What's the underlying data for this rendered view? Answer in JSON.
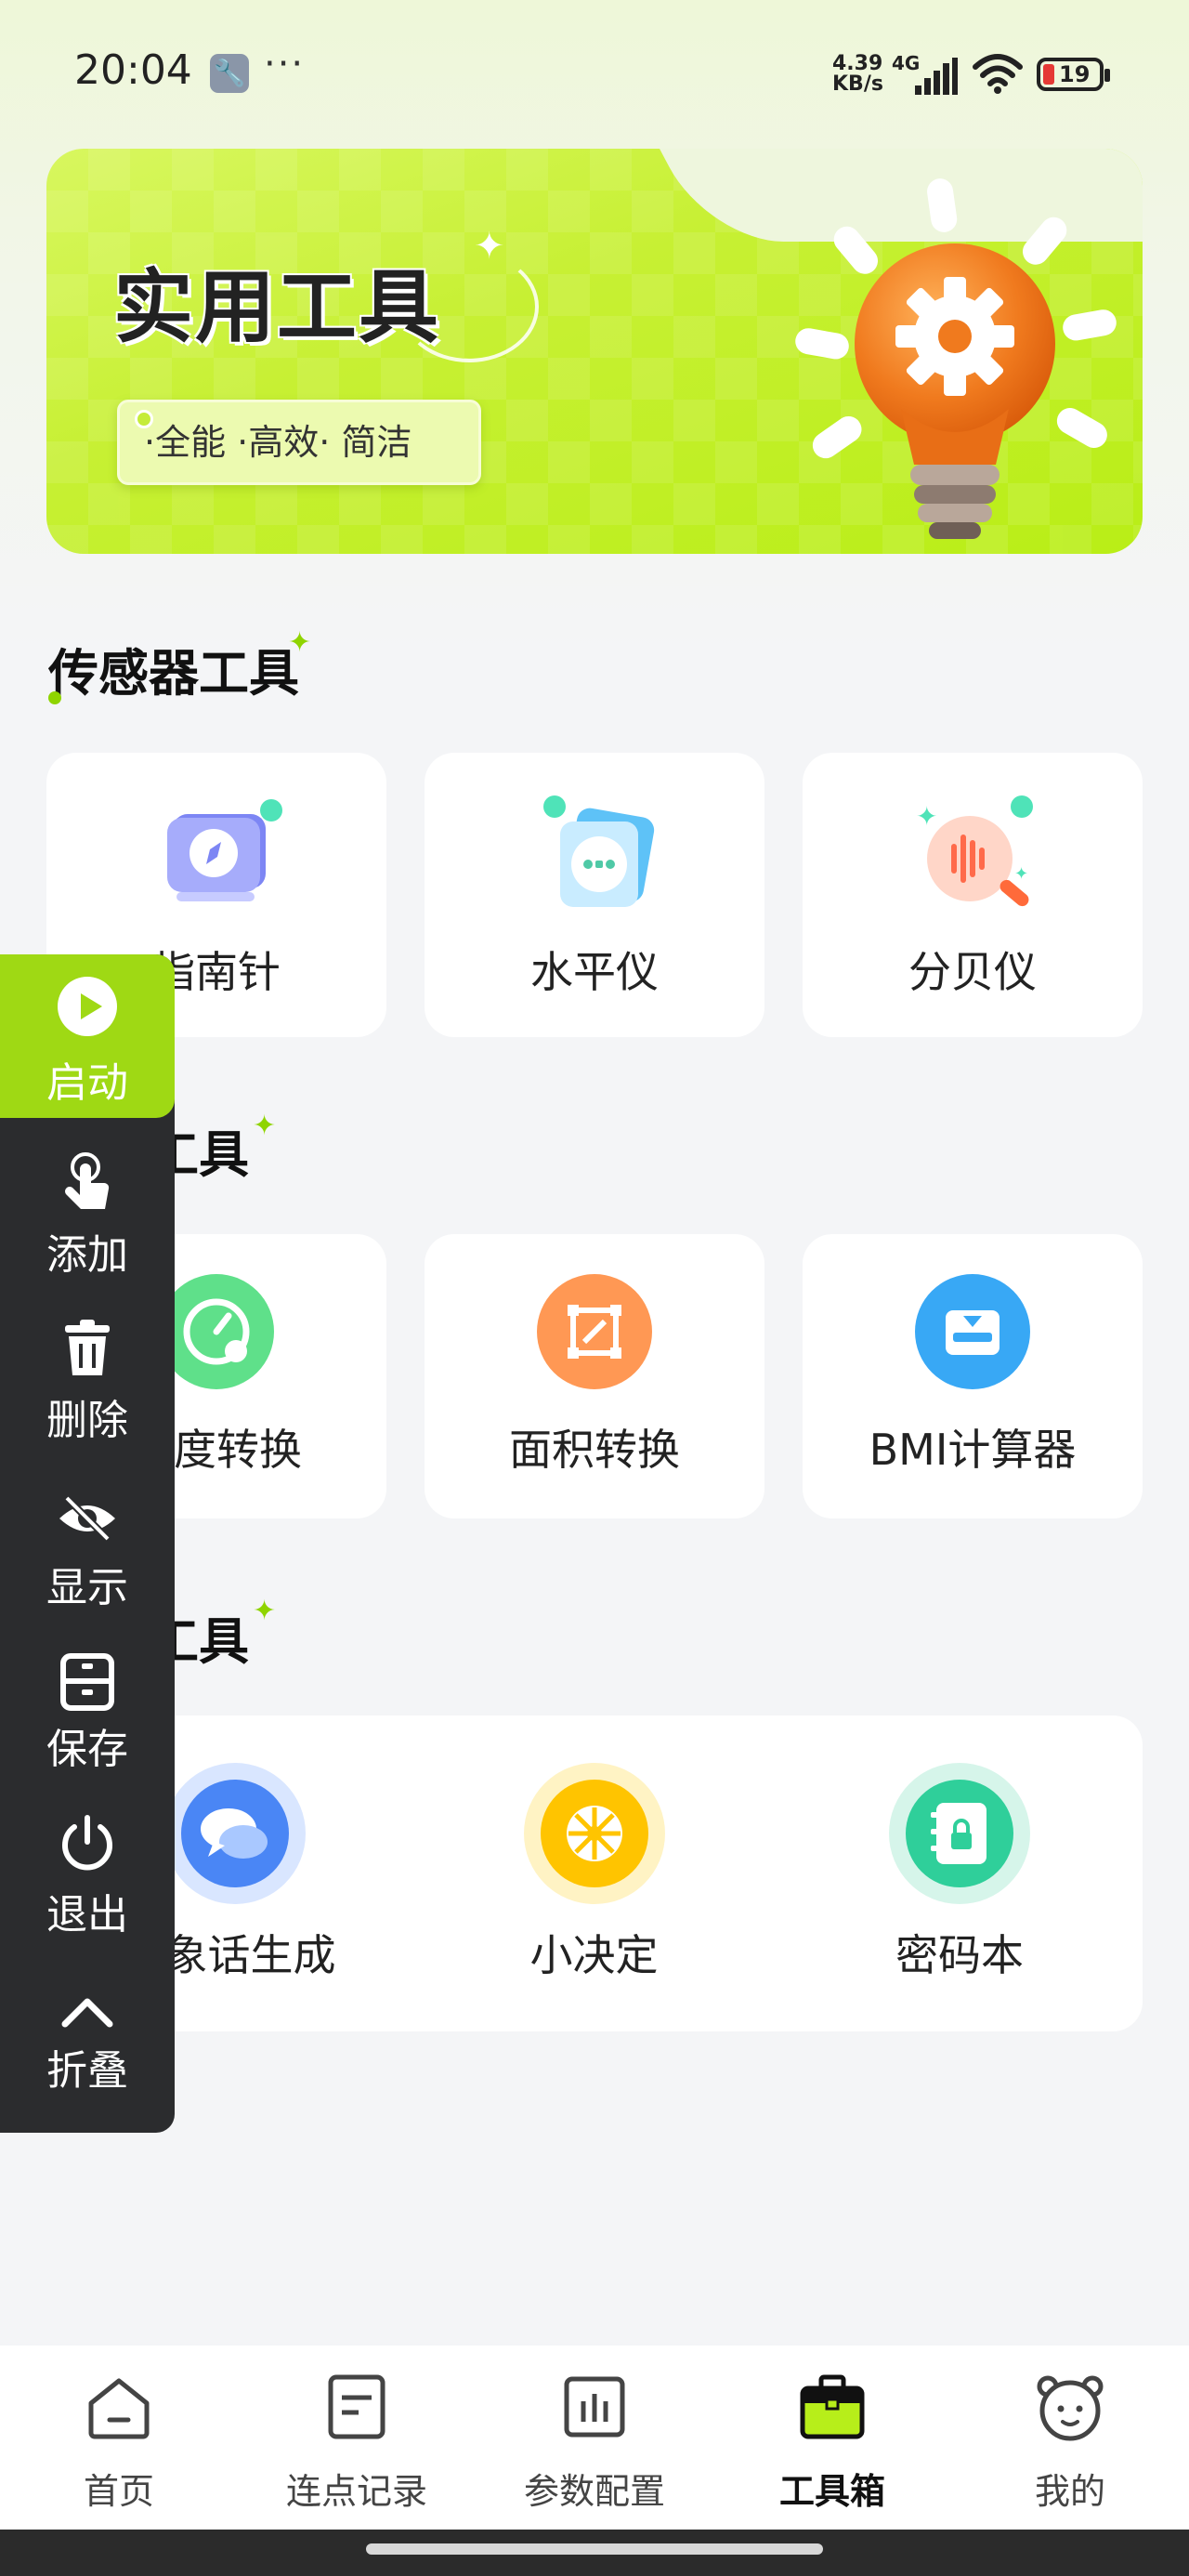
{
  "status_bar": {
    "time": "20:04",
    "wrench_icon": "wrench-icon",
    "dots": "···",
    "speed_value": "4.39",
    "speed_unit": "KB/s",
    "network": "4G",
    "battery": "19"
  },
  "banner": {
    "title": "实用工具",
    "tagline": "·全能 ·高效· 简洁"
  },
  "sections": {
    "sensor": {
      "title": "传感器工具",
      "tools": [
        {
          "label": "指南针",
          "icon": "compass-icon"
        },
        {
          "label": "水平仪",
          "icon": "level-icon"
        },
        {
          "label": "分贝仪",
          "icon": "decibel-icon"
        }
      ]
    },
    "calc": {
      "title": "计算工具",
      "tools": [
        {
          "label": "速度转换",
          "icon": "speedometer-icon"
        },
        {
          "label": "面积转换",
          "icon": "area-icon"
        },
        {
          "label": "BMI计算器",
          "icon": "scale-icon"
        }
      ]
    },
    "other": {
      "title": "其他工具",
      "tools": [
        {
          "label": "抽象话生成",
          "icon": "chat-icon"
        },
        {
          "label": "小决定",
          "icon": "wheel-icon"
        },
        {
          "label": "密码本",
          "icon": "notebook-lock-icon"
        }
      ]
    }
  },
  "float_panel": {
    "start": "启动",
    "add": "添加",
    "delete": "删除",
    "show": "显示",
    "save": "保存",
    "exit": "退出",
    "collapse": "折叠"
  },
  "bottom_nav": [
    {
      "label": "首页",
      "icon": "home-icon"
    },
    {
      "label": "连点记录",
      "icon": "document-icon"
    },
    {
      "label": "参数配置",
      "icon": "bar-chart-icon"
    },
    {
      "label": "工具箱",
      "icon": "toolbox-icon",
      "active": true
    },
    {
      "label": "我的",
      "icon": "bear-face-icon"
    }
  ],
  "colors": {
    "accent": "#9fd914",
    "panel": "#2b2c2e",
    "background": "#f4f5f7"
  }
}
